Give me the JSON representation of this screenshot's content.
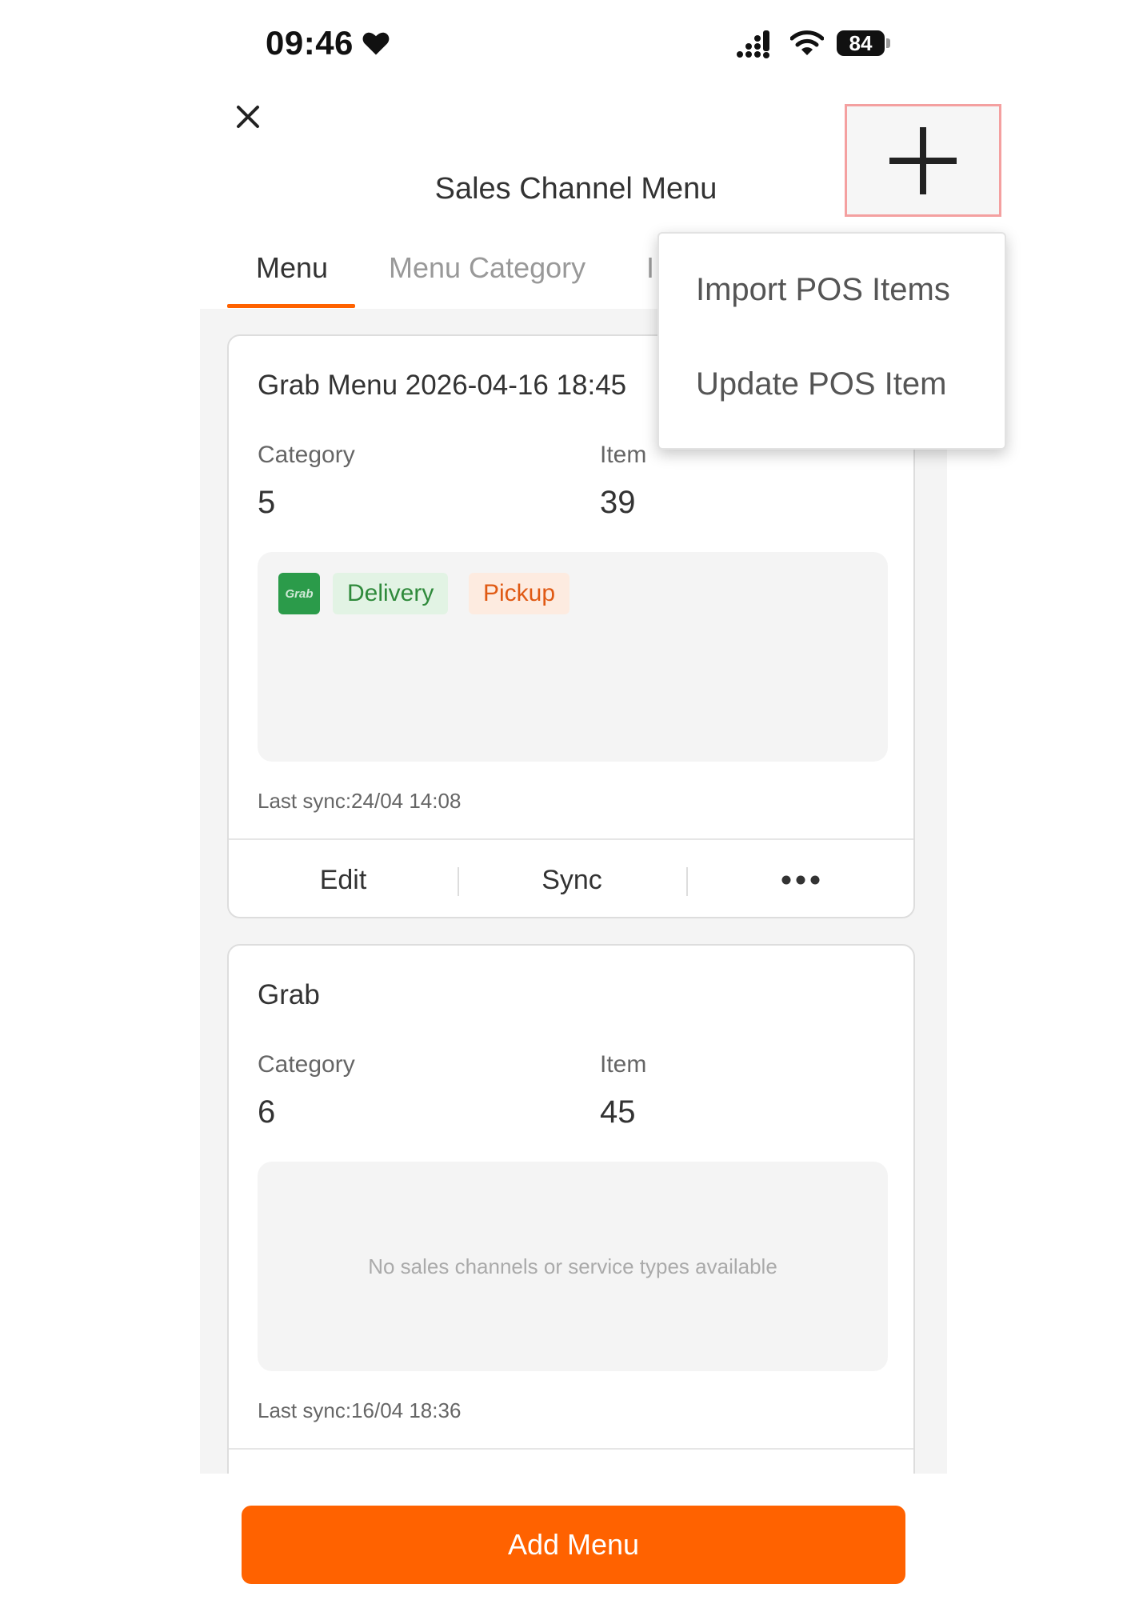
{
  "status_bar": {
    "time": "09:46",
    "battery": "84"
  },
  "header": {
    "title": "Sales Channel Menu"
  },
  "tabs": [
    {
      "label": "Menu",
      "active": true
    },
    {
      "label": "Menu Category",
      "active": false
    },
    {
      "label": "I",
      "active": false
    }
  ],
  "dropdown": {
    "items": [
      {
        "label": "Import POS Items"
      },
      {
        "label": "Update POS Item"
      }
    ]
  },
  "menus": [
    {
      "title": "Grab Menu 2026-04-16 18:45",
      "category_label": "Category",
      "category_value": "5",
      "item_label": "Item",
      "item_value": "39",
      "channel_logo_text": "Grab",
      "tags": [
        "Delivery",
        "Pickup"
      ],
      "last_sync": "Last sync:24/04 14:08",
      "actions": {
        "edit": "Edit",
        "sync": "Sync"
      }
    },
    {
      "title": "Grab",
      "category_label": "Category",
      "category_value": "6",
      "item_label": "Item",
      "item_value": "45",
      "empty_text": "No sales channels or service types available",
      "last_sync": "Last sync:16/04 18:36"
    }
  ],
  "footer": {
    "add_menu_label": "Add Menu"
  },
  "colors": {
    "accent": "#ff6200",
    "grab_green": "#2b9b4a",
    "delivery_text": "#2f8a3b",
    "pickup_text": "#e05a14"
  }
}
